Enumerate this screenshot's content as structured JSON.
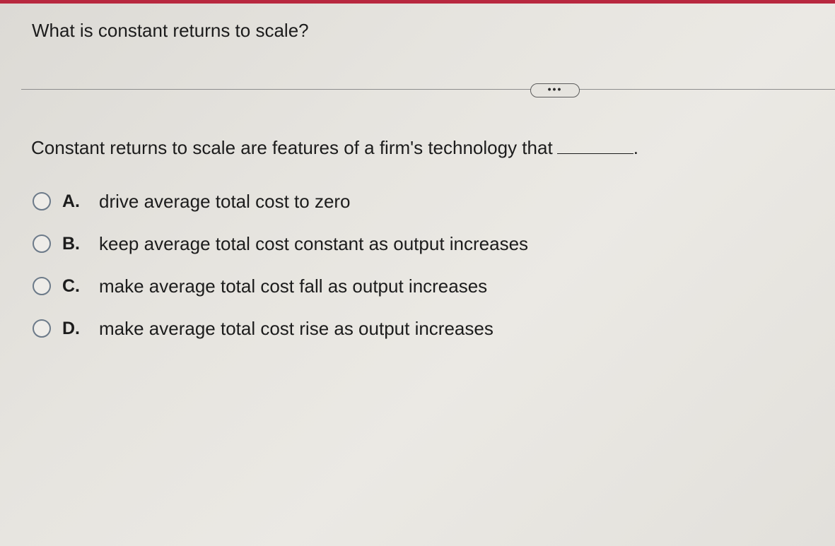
{
  "question": {
    "title": "What is constant returns to scale?",
    "more_label": "•••",
    "stem": "Constant returns to scale are features of a firm's technology that",
    "stem_end": "."
  },
  "options": [
    {
      "letter": "A.",
      "text": "drive average total cost to zero"
    },
    {
      "letter": "B.",
      "text": "keep average total cost constant as output increases"
    },
    {
      "letter": "C.",
      "text": "make average total cost fall as output increases"
    },
    {
      "letter": "D.",
      "text": "make average total cost rise as output increases"
    }
  ],
  "colors": {
    "accent": "#b8283f",
    "radio_border": "#6c7a89",
    "text": "#1c1c1c"
  }
}
